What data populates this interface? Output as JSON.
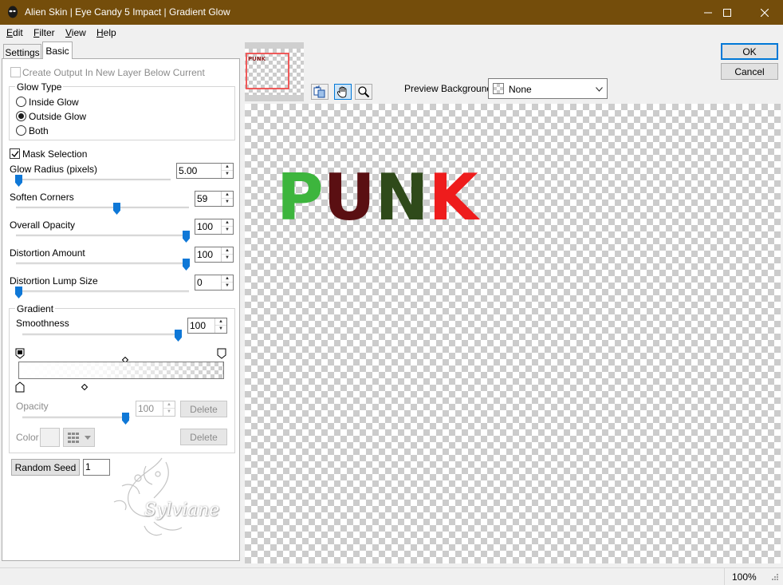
{
  "window": {
    "title": "Alien Skin | Eye Candy 5 Impact | Gradient Glow",
    "titlebar_color": "#744d0b"
  },
  "menu": {
    "items": [
      {
        "label": "Edit",
        "accel": "E",
        "rest": "dit"
      },
      {
        "label": "Filter",
        "accel": "F",
        "rest": "ilter"
      },
      {
        "label": "View",
        "accel": "V",
        "rest": "iew"
      },
      {
        "label": "Help",
        "accel": "H",
        "rest": "elp"
      }
    ]
  },
  "tabs": {
    "settings": "Settings",
    "basic": "Basic",
    "active": "Basic"
  },
  "basic": {
    "create_output_label": "Create Output In New Layer Below Current",
    "create_output_checked": false,
    "glow_type": {
      "title": "Glow Type",
      "options": [
        "Inside Glow",
        "Outside Glow",
        "Both"
      ],
      "selected": "Outside Glow"
    },
    "mask_selection_label": "Mask Selection",
    "mask_selection_checked": true,
    "sliders": {
      "glow_radius": {
        "label": "Glow Radius (pixels)",
        "value": "5.00",
        "fraction": 0.0
      },
      "soften_corners": {
        "label": "Soften Corners",
        "value": "59",
        "fraction": 0.59
      },
      "overall_opacity": {
        "label": "Overall Opacity",
        "value": "100",
        "fraction": 1.0
      },
      "distortion_amount": {
        "label": "Distortion Amount",
        "value": "100",
        "fraction": 1.0
      },
      "distortion_lump_size": {
        "label": "Distortion Lump Size",
        "value": "0",
        "fraction": 0.0
      }
    },
    "gradient": {
      "title": "Gradient",
      "smoothness_label": "Smoothness",
      "smoothness_value": "100",
      "smoothness_fraction": 1.0,
      "opacity_label": "Opacity",
      "opacity_value": "100",
      "opacity_fraction": 1.0,
      "color_label": "Color",
      "delete_label": "Delete"
    },
    "random_seed_label": "Random Seed",
    "random_seed_value": "1",
    "watermark_text": "Sylviane"
  },
  "dialog": {
    "ok_label": "OK",
    "cancel_label": "Cancel"
  },
  "preview": {
    "background_label": "Preview Background:",
    "background_value": "None",
    "thumbnail_text": "PUNK",
    "word": [
      {
        "char": "P",
        "color": "#3db53d"
      },
      {
        "char": "U",
        "color": "#5a0f12"
      },
      {
        "char": "N",
        "color": "#2f4a1a"
      },
      {
        "char": "K",
        "color": "#ee1c1c"
      }
    ],
    "tools": [
      "before-after-icon",
      "hand-icon",
      "zoom-icon"
    ]
  },
  "status": {
    "zoom": "100%"
  }
}
